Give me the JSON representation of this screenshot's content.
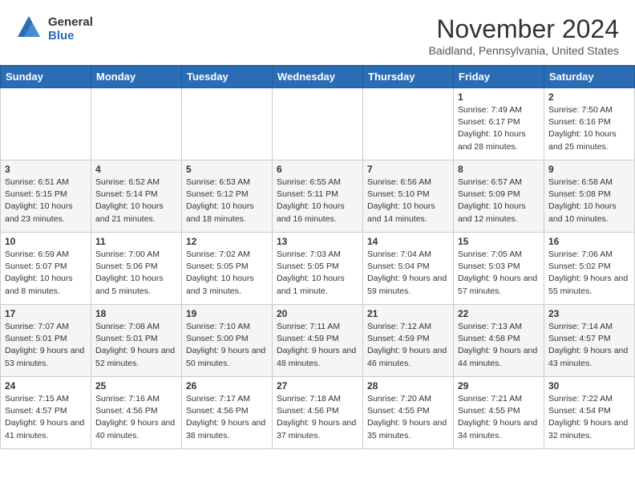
{
  "header": {
    "logo_general": "General",
    "logo_blue": "Blue",
    "month_year": "November 2024",
    "location": "Baidland, Pennsylvania, United States"
  },
  "weekdays": [
    "Sunday",
    "Monday",
    "Tuesday",
    "Wednesday",
    "Thursday",
    "Friday",
    "Saturday"
  ],
  "weeks": [
    [
      {
        "day": "",
        "info": ""
      },
      {
        "day": "",
        "info": ""
      },
      {
        "day": "",
        "info": ""
      },
      {
        "day": "",
        "info": ""
      },
      {
        "day": "",
        "info": ""
      },
      {
        "day": "1",
        "info": "Sunrise: 7:49 AM\nSunset: 6:17 PM\nDaylight: 10 hours and 28 minutes."
      },
      {
        "day": "2",
        "info": "Sunrise: 7:50 AM\nSunset: 6:16 PM\nDaylight: 10 hours and 25 minutes."
      }
    ],
    [
      {
        "day": "3",
        "info": "Sunrise: 6:51 AM\nSunset: 5:15 PM\nDaylight: 10 hours and 23 minutes."
      },
      {
        "day": "4",
        "info": "Sunrise: 6:52 AM\nSunset: 5:14 PM\nDaylight: 10 hours and 21 minutes."
      },
      {
        "day": "5",
        "info": "Sunrise: 6:53 AM\nSunset: 5:12 PM\nDaylight: 10 hours and 18 minutes."
      },
      {
        "day": "6",
        "info": "Sunrise: 6:55 AM\nSunset: 5:11 PM\nDaylight: 10 hours and 16 minutes."
      },
      {
        "day": "7",
        "info": "Sunrise: 6:56 AM\nSunset: 5:10 PM\nDaylight: 10 hours and 14 minutes."
      },
      {
        "day": "8",
        "info": "Sunrise: 6:57 AM\nSunset: 5:09 PM\nDaylight: 10 hours and 12 minutes."
      },
      {
        "day": "9",
        "info": "Sunrise: 6:58 AM\nSunset: 5:08 PM\nDaylight: 10 hours and 10 minutes."
      }
    ],
    [
      {
        "day": "10",
        "info": "Sunrise: 6:59 AM\nSunset: 5:07 PM\nDaylight: 10 hours and 8 minutes."
      },
      {
        "day": "11",
        "info": "Sunrise: 7:00 AM\nSunset: 5:06 PM\nDaylight: 10 hours and 5 minutes."
      },
      {
        "day": "12",
        "info": "Sunrise: 7:02 AM\nSunset: 5:05 PM\nDaylight: 10 hours and 3 minutes."
      },
      {
        "day": "13",
        "info": "Sunrise: 7:03 AM\nSunset: 5:05 PM\nDaylight: 10 hours and 1 minute."
      },
      {
        "day": "14",
        "info": "Sunrise: 7:04 AM\nSunset: 5:04 PM\nDaylight: 9 hours and 59 minutes."
      },
      {
        "day": "15",
        "info": "Sunrise: 7:05 AM\nSunset: 5:03 PM\nDaylight: 9 hours and 57 minutes."
      },
      {
        "day": "16",
        "info": "Sunrise: 7:06 AM\nSunset: 5:02 PM\nDaylight: 9 hours and 55 minutes."
      }
    ],
    [
      {
        "day": "17",
        "info": "Sunrise: 7:07 AM\nSunset: 5:01 PM\nDaylight: 9 hours and 53 minutes."
      },
      {
        "day": "18",
        "info": "Sunrise: 7:08 AM\nSunset: 5:01 PM\nDaylight: 9 hours and 52 minutes."
      },
      {
        "day": "19",
        "info": "Sunrise: 7:10 AM\nSunset: 5:00 PM\nDaylight: 9 hours and 50 minutes."
      },
      {
        "day": "20",
        "info": "Sunrise: 7:11 AM\nSunset: 4:59 PM\nDaylight: 9 hours and 48 minutes."
      },
      {
        "day": "21",
        "info": "Sunrise: 7:12 AM\nSunset: 4:59 PM\nDaylight: 9 hours and 46 minutes."
      },
      {
        "day": "22",
        "info": "Sunrise: 7:13 AM\nSunset: 4:58 PM\nDaylight: 9 hours and 44 minutes."
      },
      {
        "day": "23",
        "info": "Sunrise: 7:14 AM\nSunset: 4:57 PM\nDaylight: 9 hours and 43 minutes."
      }
    ],
    [
      {
        "day": "24",
        "info": "Sunrise: 7:15 AM\nSunset: 4:57 PM\nDaylight: 9 hours and 41 minutes."
      },
      {
        "day": "25",
        "info": "Sunrise: 7:16 AM\nSunset: 4:56 PM\nDaylight: 9 hours and 40 minutes."
      },
      {
        "day": "26",
        "info": "Sunrise: 7:17 AM\nSunset: 4:56 PM\nDaylight: 9 hours and 38 minutes."
      },
      {
        "day": "27",
        "info": "Sunrise: 7:18 AM\nSunset: 4:56 PM\nDaylight: 9 hours and 37 minutes."
      },
      {
        "day": "28",
        "info": "Sunrise: 7:20 AM\nSunset: 4:55 PM\nDaylight: 9 hours and 35 minutes."
      },
      {
        "day": "29",
        "info": "Sunrise: 7:21 AM\nSunset: 4:55 PM\nDaylight: 9 hours and 34 minutes."
      },
      {
        "day": "30",
        "info": "Sunrise: 7:22 AM\nSunset: 4:54 PM\nDaylight: 9 hours and 32 minutes."
      }
    ]
  ]
}
